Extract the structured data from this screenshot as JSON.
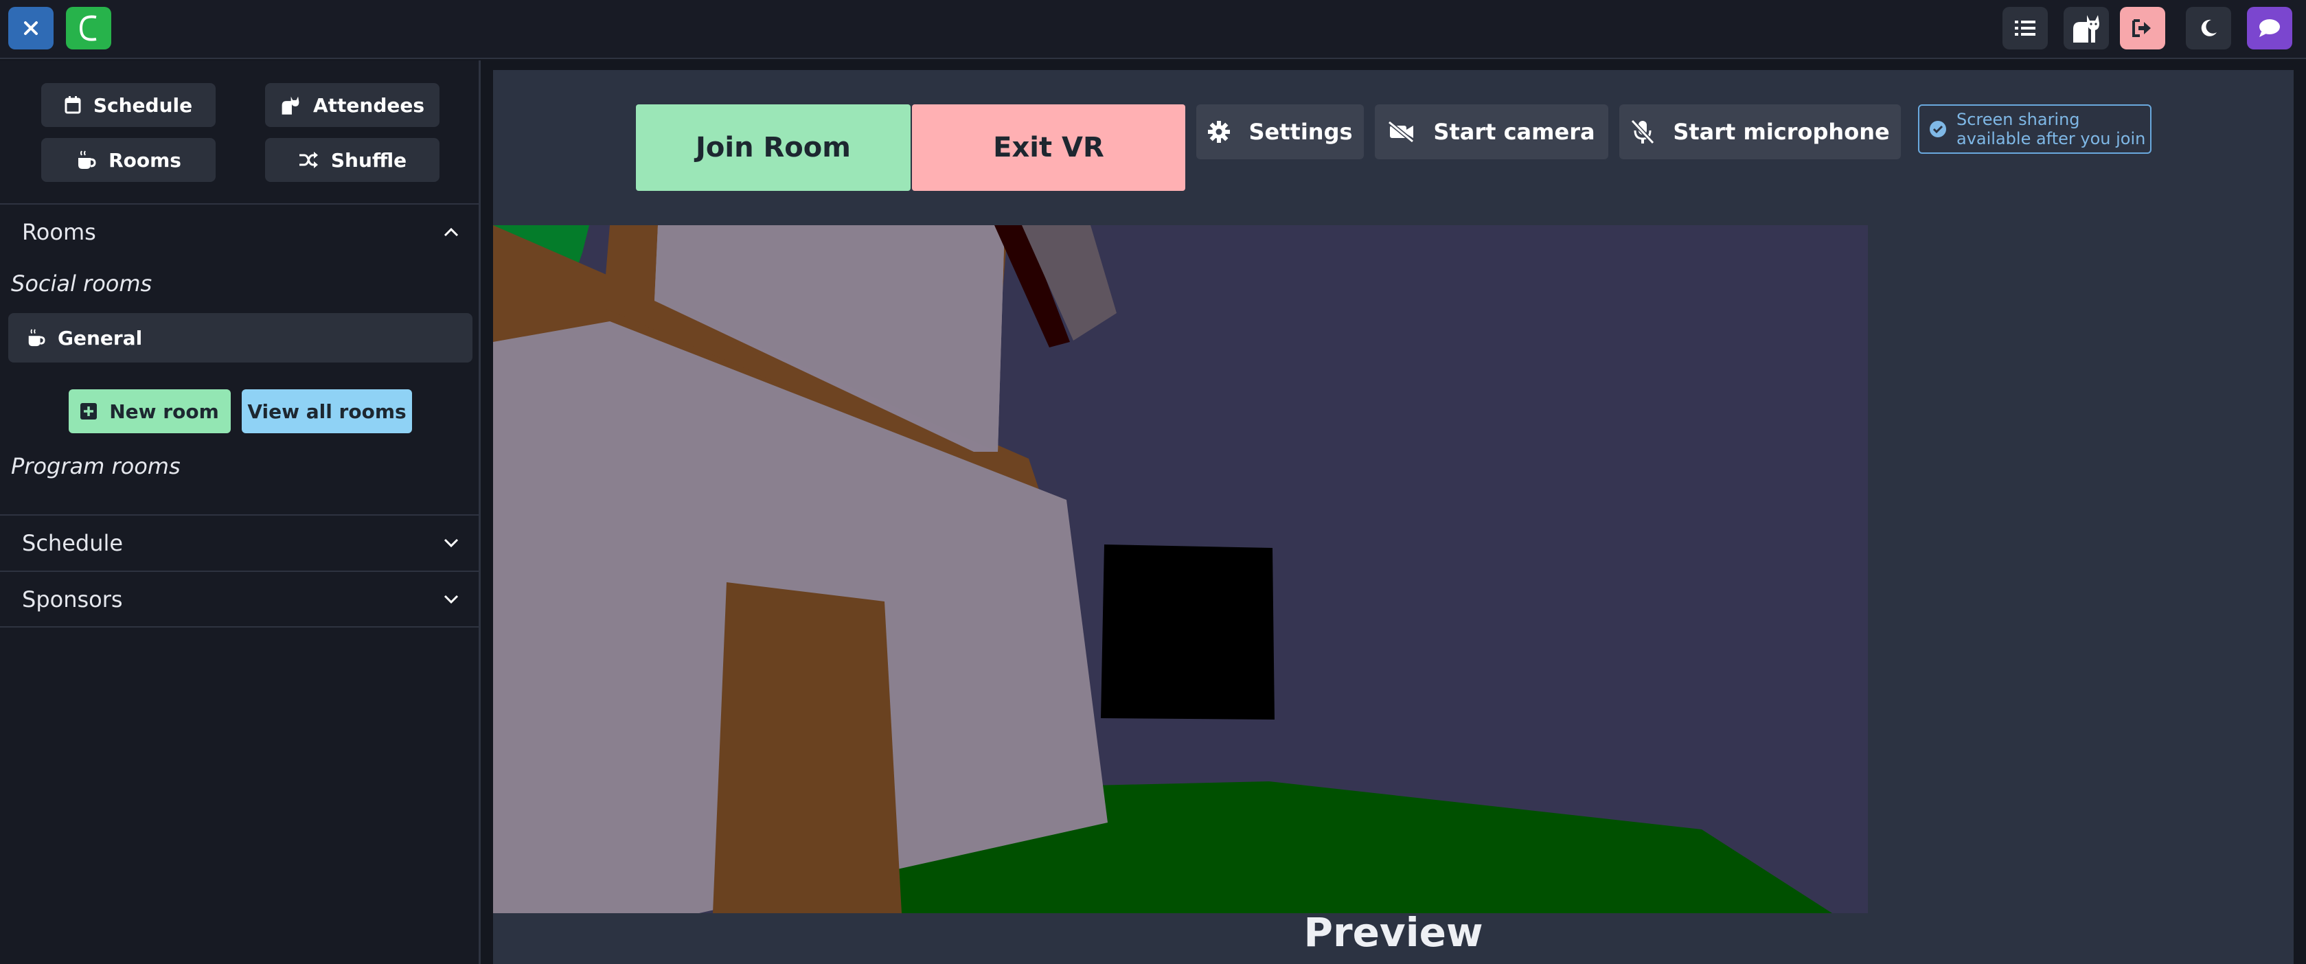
{
  "topbar": {
    "icons": [
      "close-icon",
      "conference-logo-icon",
      "list-icon",
      "cat-icon",
      "logout-icon",
      "moon-icon",
      "chat-icon"
    ],
    "colors": {
      "close": "#2f6bb5",
      "logo": "#27b34b",
      "logout": "#f7a7ab",
      "chat": "#7b46cf"
    }
  },
  "sidebar": {
    "nav": {
      "schedule": "Schedule",
      "attendees": "Attendees",
      "rooms": "Rooms",
      "shuffle": "Shuffle"
    },
    "rooms_section": {
      "title": "Rooms",
      "social_label": "Social rooms",
      "social_rooms": [
        {
          "label": "General",
          "icon": "coffee-icon"
        }
      ],
      "new_room_label": "New room",
      "view_all_label": "View all rooms",
      "program_label": "Program rooms"
    },
    "schedule_section": {
      "title": "Schedule"
    },
    "sponsors_section": {
      "title": "Sponsors"
    }
  },
  "main": {
    "join_room_label": "Join Room",
    "exit_vr_label": "Exit VR",
    "settings_label": "Settings",
    "camera_label": "Start camera",
    "microphone_label": "Start microphone",
    "screen_share_note_line1": "Screen sharing",
    "screen_share_note_line2": "available after you join",
    "preview_label": "Preview",
    "colors": {
      "join": "#9be6b7",
      "exit_vr": "#ffb0b3",
      "scene_wall": "#363552"
    }
  }
}
